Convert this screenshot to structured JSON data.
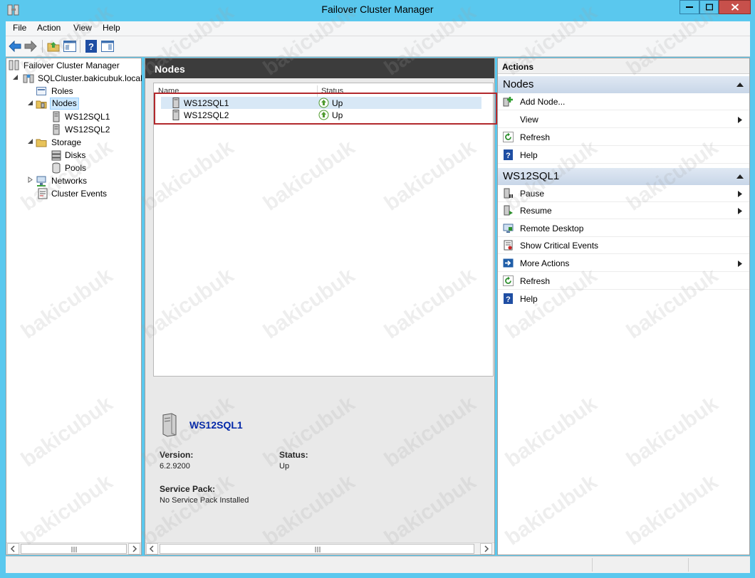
{
  "window": {
    "title": "Failover Cluster Manager"
  },
  "menu": [
    "File",
    "Action",
    "View",
    "Help"
  ],
  "tree": {
    "root": "Failover Cluster Manager",
    "cluster": "SQLCluster.bakicubuk.local",
    "roles": "Roles",
    "nodes": "Nodes",
    "node1": "WS12SQL1",
    "node2": "WS12SQL2",
    "storage": "Storage",
    "disks": "Disks",
    "pools": "Pools",
    "networks": "Networks",
    "events": "Cluster Events"
  },
  "center": {
    "header": "Nodes",
    "columns": {
      "name": "Name",
      "status": "Status"
    },
    "rows": [
      {
        "name": "WS12SQL1",
        "status": "Up"
      },
      {
        "name": "WS12SQL2",
        "status": "Up"
      }
    ],
    "details": {
      "title": "WS12SQL1",
      "version_label": "Version:",
      "version": "6.2.9200",
      "status_label": "Status:",
      "status": "Up",
      "sp_label": "Service Pack:",
      "sp": "No Service Pack Installed"
    }
  },
  "actions": {
    "header": "Actions",
    "section1": "Nodes",
    "s1_items": [
      "Add Node...",
      "View",
      "Refresh",
      "Help"
    ],
    "section2": "WS12SQL1",
    "s2_items": [
      "Pause",
      "Resume",
      "Remote Desktop",
      "Show Critical Events",
      "More Actions",
      "Refresh",
      "Help"
    ]
  },
  "watermark": "bakicubuk",
  "colors": {
    "titlebar": "#5ac8ee",
    "close": "#c7504b",
    "header_dark": "#3c3c3c",
    "section": "#c8d6e8",
    "link_blue": "#0026a8",
    "highlight": "#b2282c"
  }
}
